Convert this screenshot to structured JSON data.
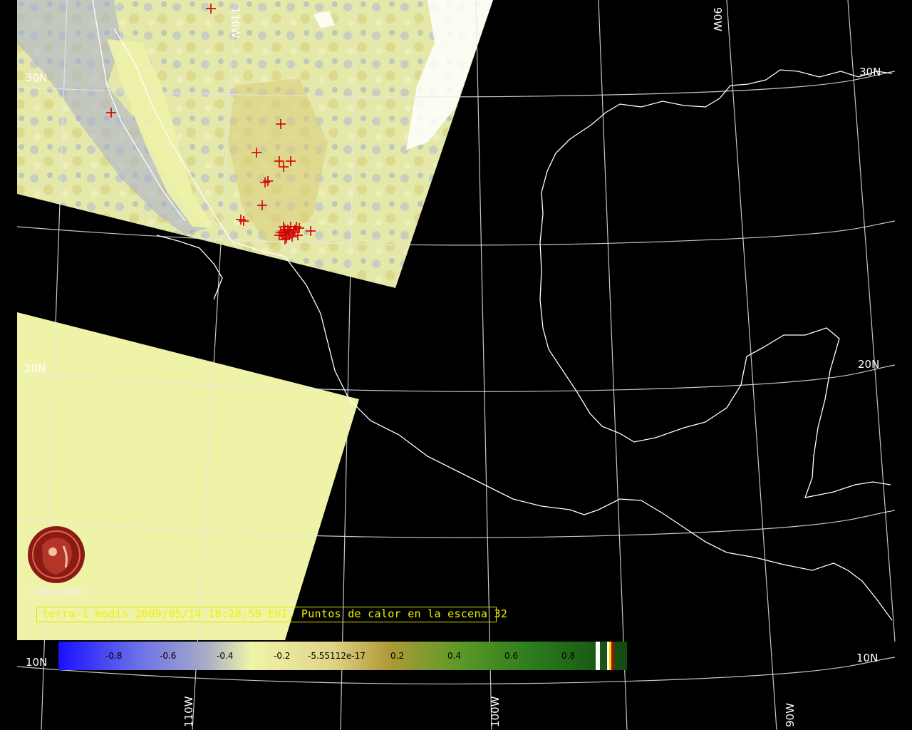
{
  "caption": {
    "text": "terra-1 modis 2009/05/14 18:20:59 EVI, Puntos de calor en la escena 32"
  },
  "logo": {
    "name": "CONABIO"
  },
  "graticule_labels": {
    "lat": [
      "30N",
      "20N",
      "10N"
    ],
    "lon": [
      "110W",
      "100W",
      "90W"
    ]
  },
  "colorbar": {
    "tick_labels": [
      "-0.8",
      "-0.6",
      "-0.4",
      "-0.2",
      "-5.55112e-17",
      "0.2",
      "0.4",
      "0.6",
      "0.8"
    ],
    "stops": [
      "#1a10ff",
      "#8890d8",
      "#c8cca8",
      "#f0f4a8",
      "#d8c868",
      "#b09a38",
      "#689a28",
      "#2e8020",
      "#145010"
    ]
  },
  "hotspot_count": 32,
  "colors": {
    "background": "#000000",
    "swath": "#eef3a8",
    "hotspot": "#d00000",
    "caption": "#f2ef00",
    "logo": "#8b1a14"
  }
}
